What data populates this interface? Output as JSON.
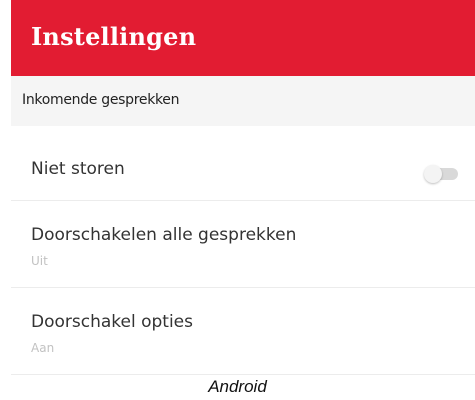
{
  "app_bar": {
    "title": "Instellingen",
    "background_color": "#e21c32"
  },
  "section": {
    "header": "Inkomende gesprekken"
  },
  "settings": [
    {
      "title": "Niet storen",
      "toggle": {
        "on": false,
        "icon": "switch-off-icon"
      }
    },
    {
      "title": "Doorschakelen alle gesprekken",
      "subtitle": "Uit"
    },
    {
      "title": "Doorschakel opties",
      "subtitle": "Aan"
    }
  ],
  "caption": "Android"
}
